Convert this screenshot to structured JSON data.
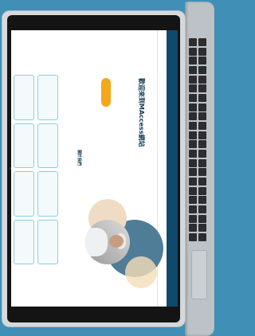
{
  "nav": {
    "items": []
  },
  "hero": {
    "title": "歡迎來到MAccess網站",
    "paragraph": "",
    "cta_label": ""
  },
  "section": {
    "title": "關於我們",
    "text": ""
  },
  "tiles": []
}
